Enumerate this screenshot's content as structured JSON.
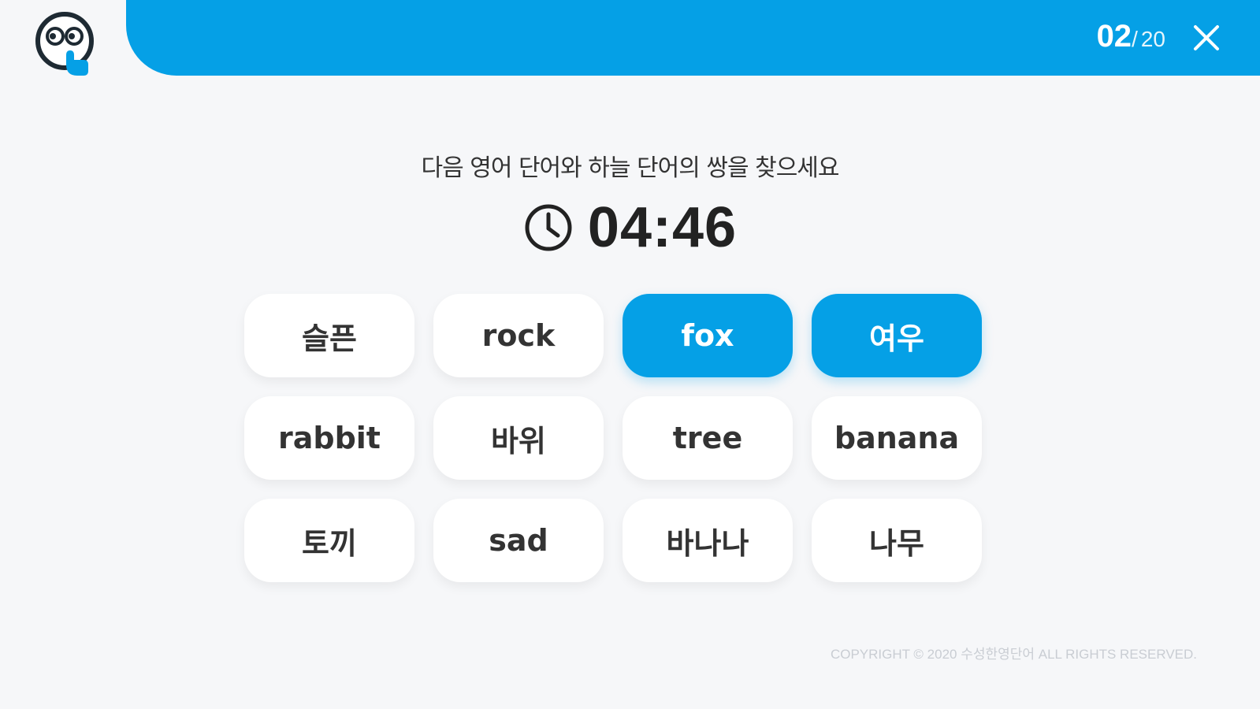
{
  "header": {
    "progress_current": "02",
    "progress_separator": "/",
    "progress_total": "20",
    "accent_color": "#05a0e6",
    "logo_icon": "smiley-touch-icon",
    "close_icon": "close-icon"
  },
  "quiz": {
    "instruction": "다음 영어 단어와 하늘 단어의 쌍을 찾으세요",
    "timer": "04:46",
    "timer_icon": "clock-icon",
    "cards": [
      {
        "label": "슬픈",
        "selected": false
      },
      {
        "label": "rock",
        "selected": false
      },
      {
        "label": "fox",
        "selected": true
      },
      {
        "label": "여우",
        "selected": true
      },
      {
        "label": "rabbit",
        "selected": false
      },
      {
        "label": "바위",
        "selected": false
      },
      {
        "label": "tree",
        "selected": false
      },
      {
        "label": "banana",
        "selected": false
      },
      {
        "label": "토끼",
        "selected": false
      },
      {
        "label": "sad",
        "selected": false
      },
      {
        "label": "바나나",
        "selected": false
      },
      {
        "label": "나무",
        "selected": false
      }
    ]
  },
  "footer": {
    "copyright": "COPYRIGHT © 2020 수성한영단어 ALL RIGHTS RESERVED."
  }
}
